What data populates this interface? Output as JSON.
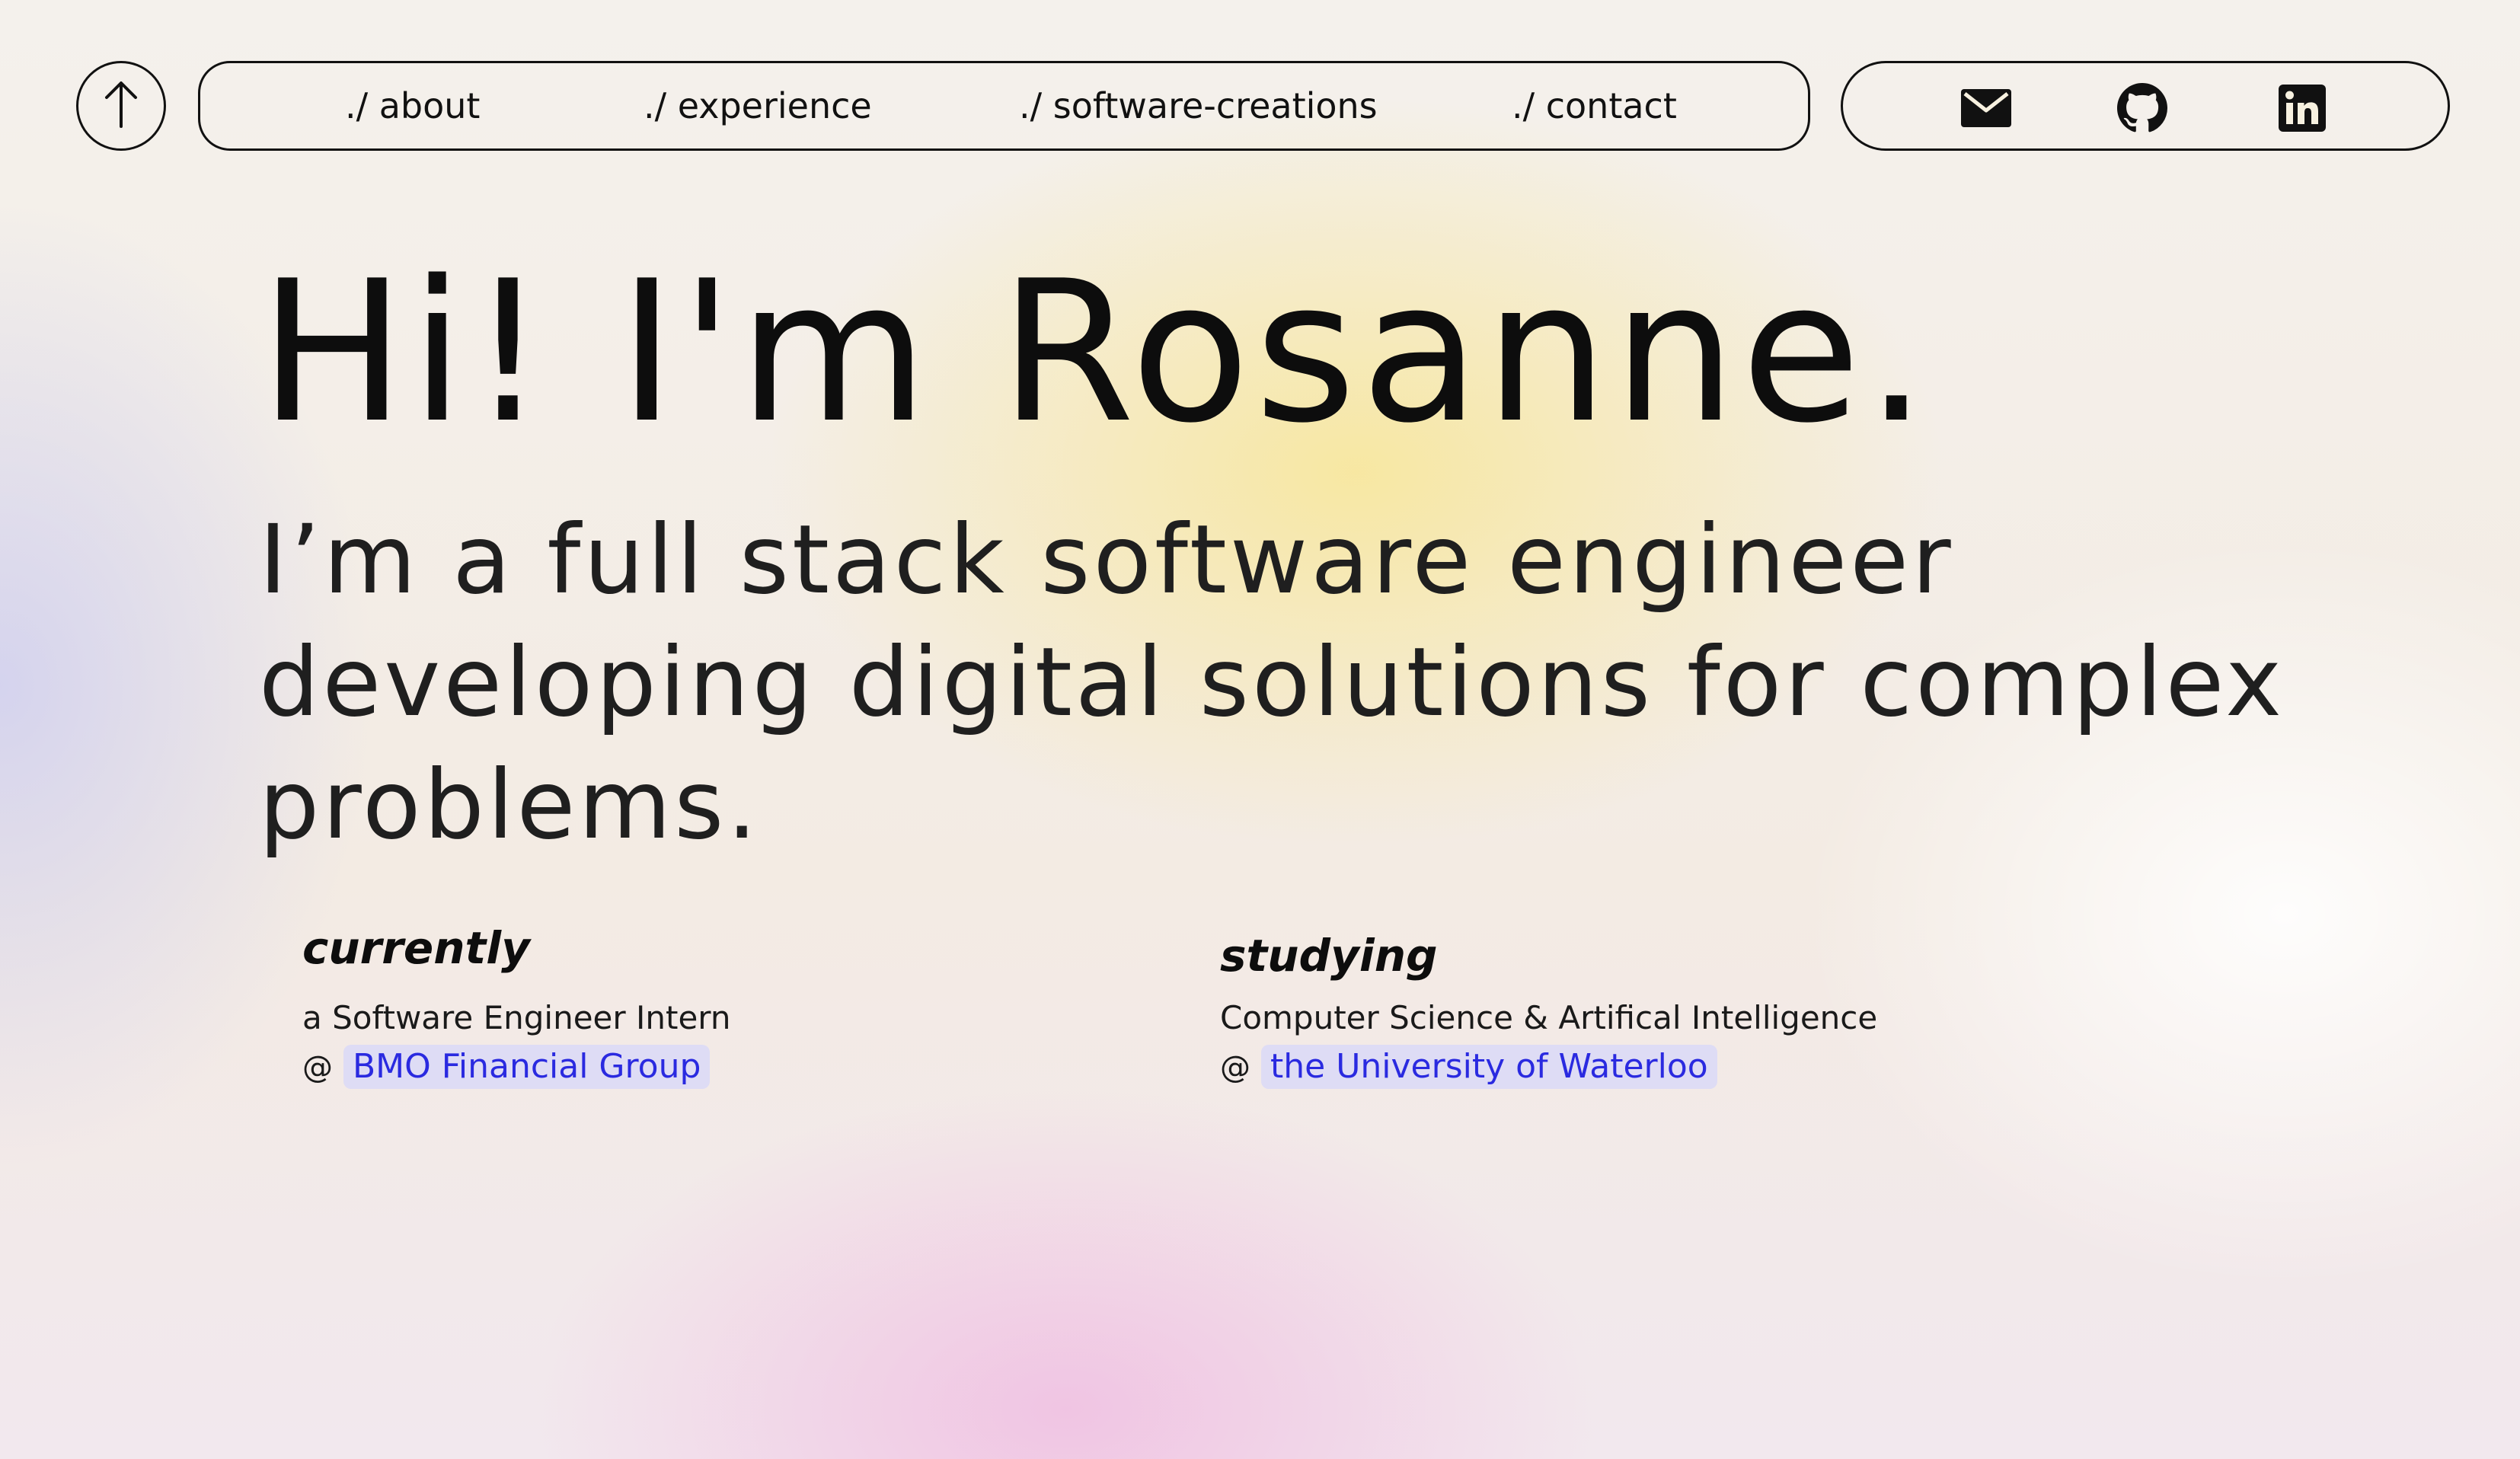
{
  "nav": {
    "links": [
      {
        "label": "./ about"
      },
      {
        "label": "./ experience"
      },
      {
        "label": "./ software-creations"
      },
      {
        "label": "./ contact"
      }
    ],
    "social_icons": [
      "mail-icon",
      "github-icon",
      "linkedin-icon"
    ],
    "up_icon": "arrow-up-icon"
  },
  "hero": {
    "title": "Hi! I'm Rosanne.",
    "subtitle": "I’m a full stack software engineer developing digital solutions for complex problems."
  },
  "currently": {
    "heading": "currently",
    "role": "a Software Engineer Intern",
    "at": "@",
    "org": "BMO Financial Group"
  },
  "studying": {
    "heading": "studying",
    "program": "Computer Science & Artifical Intelligence",
    "at": "@",
    "school": "the University of Waterloo"
  },
  "colors": {
    "text": "#111111",
    "link": "#2a2ae0",
    "link_highlight": "#d7d7fa",
    "gradient_yellow": "#f8e696",
    "gradient_pink": "#f0bee1",
    "gradient_lavender": "#cdcdf0"
  }
}
